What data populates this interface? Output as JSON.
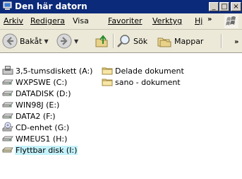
{
  "window": {
    "title": "Den här datorn",
    "minimize_label": "_",
    "maximize_label": "□",
    "close_label": "×"
  },
  "menubar": {
    "items": [
      {
        "label": "Arkiv"
      },
      {
        "label": "Redigera"
      },
      {
        "label": "Visa"
      },
      {
        "label": "Favoriter"
      },
      {
        "label": "Verktyg"
      },
      {
        "label": "Hj"
      }
    ],
    "overflow": "»"
  },
  "toolbar": {
    "back_label": "Bakåt",
    "search_label": "Sök",
    "folders_label": "Mappar",
    "overflow": "»"
  },
  "drives": [
    {
      "label": "3,5-tumsdiskett (A:)",
      "icon": "floppy-drive-icon"
    },
    {
      "label": "WXPSWE (C:)",
      "icon": "hard-drive-icon"
    },
    {
      "label": "DATADISK (D:)",
      "icon": "hard-drive-icon"
    },
    {
      "label": "WIN98J (E:)",
      "icon": "hard-drive-icon"
    },
    {
      "label": "DATA2 (F:)",
      "icon": "hard-drive-icon"
    },
    {
      "label": "CD-enhet (G:)",
      "icon": "cd-drive-icon"
    },
    {
      "label": "WMEUS1 (H:)",
      "icon": "hard-drive-icon"
    },
    {
      "label": "Flyttbar disk (I:)",
      "icon": "removable-disk-icon",
      "selected": true
    }
  ],
  "folders": [
    {
      "label": "Delade dokument",
      "icon": "shared-folder-icon"
    },
    {
      "label": "sano - dokument",
      "icon": "folder-icon"
    }
  ],
  "colors": {
    "titlebar": "#0b2a7a",
    "chrome": "#ece9d8",
    "selection": "#c5f2fb"
  }
}
